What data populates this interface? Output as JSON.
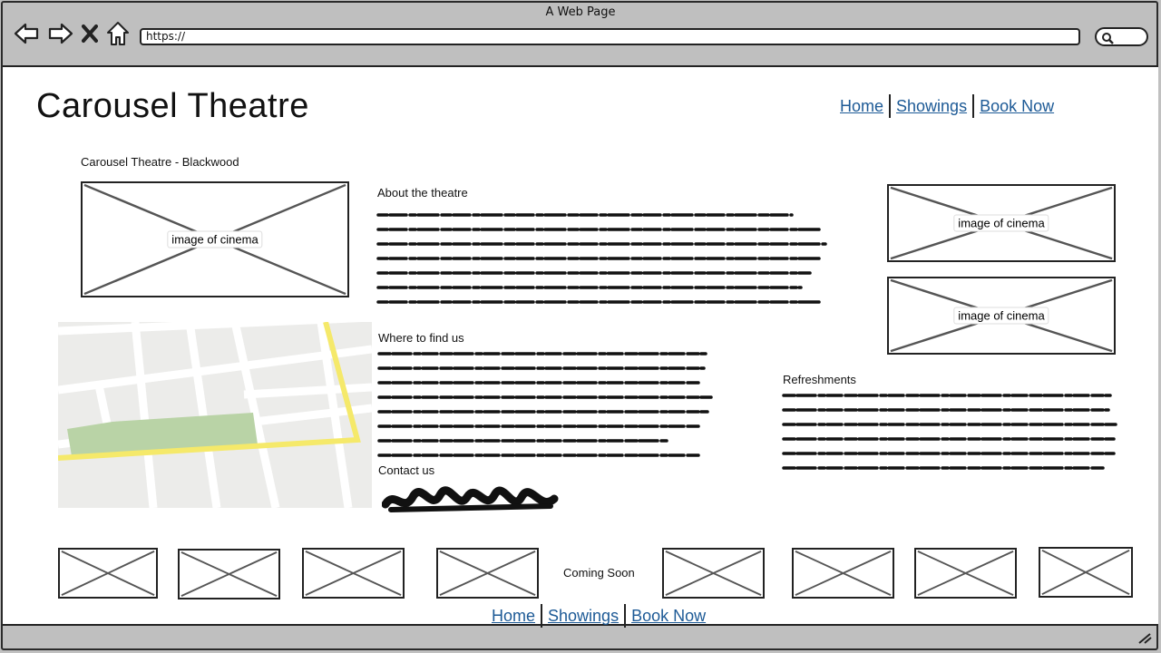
{
  "window": {
    "title": "A Web Page"
  },
  "browser": {
    "url": "https://"
  },
  "site": {
    "title": "Carousel Theatre"
  },
  "nav": {
    "home": "Home",
    "showings": "Showings",
    "book": "Book Now"
  },
  "location_heading": "Carousel Theatre - Blackwood",
  "images": {
    "main_caption": "image of cinema",
    "side1_caption": "image of cinema",
    "side2_caption": "image of cinema"
  },
  "sections": {
    "about": "About the theatre",
    "find": "Where to find us",
    "contact": "Contact us",
    "refreshments": "Refreshments"
  },
  "coming_soon": "Coming Soon",
  "footer_nav": {
    "home": "Home",
    "showings": "Showings",
    "book": "Book Now"
  },
  "colors": {
    "link": "#1d5a96",
    "map_park": "#b9d3a6",
    "map_road": "#f5e96a"
  }
}
